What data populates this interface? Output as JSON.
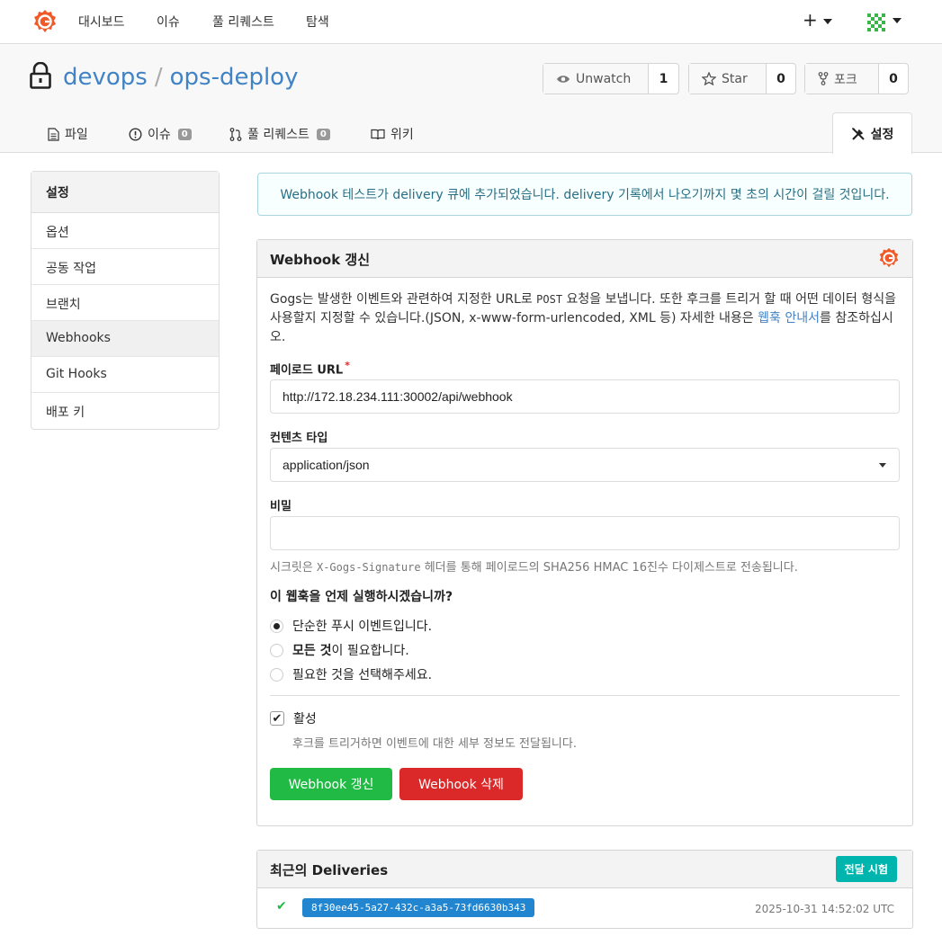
{
  "topnav": {
    "items": [
      "대시보드",
      "이슈",
      "풀 리퀘스트",
      "탐색"
    ],
    "plus": "+"
  },
  "repo": {
    "owner": "devops",
    "separator": "/",
    "name": "ops-deploy",
    "watch_label": "Unwatch",
    "watch_count": "1",
    "star_label": "Star",
    "star_count": "0",
    "fork_label": "포크",
    "fork_count": "0"
  },
  "tabs": {
    "files": "파일",
    "issues": "이슈",
    "issues_count": "0",
    "pulls": "풀 리퀘스트",
    "pulls_count": "0",
    "wiki": "위키",
    "settings": "설정"
  },
  "sidebar": {
    "header": "설정",
    "items": [
      "옵션",
      "공동 작업",
      "브랜치",
      "Webhooks",
      "Git Hooks",
      "배포 키"
    ],
    "active_index": 3
  },
  "flash": {
    "message": "Webhook 테스트가 delivery 큐에 추가되었습니다. delivery 기록에서 나오기까지 몇 초의 시간이 걸릴 것입니다."
  },
  "form": {
    "title": "Webhook 갱신",
    "desc_part1": "Gogs는 발생한 이벤트와 관련하여 지정한 URL로 ",
    "desc_code": "POST",
    "desc_part2": " 요청을 보냅니다. 또한 후크를 트리거 할 때 어떤 데이터 형식을 사용할지 지정할 수 있습니다.(JSON, x-www-form-urlencoded, XML 등) 자세한 내용은 ",
    "desc_link": "웹훅 안내서",
    "desc_part3": "를 참조하십시오.",
    "payload_label": "페이로드 URL",
    "required_mark": "*",
    "payload_value": "http://172.18.234.111:30002/api/webhook",
    "content_type_label": "컨텐츠 타입",
    "content_type_value": "application/json",
    "secret_label": "비밀",
    "secret_value": "",
    "secret_help_part1": "시크릿은 ",
    "secret_help_code": "X-Gogs-Signature",
    "secret_help_part2": " 헤더를 통해 페이로드의 SHA256 HMAC 16진수 다이제스트로 전송됩니다.",
    "events_question": "이 웹훅을 언제 실행하시겠습니까?",
    "event_push": "단순한 푸시 이벤트입니다.",
    "event_all_bold": "모든 것",
    "event_all_rest": "이 필요합니다.",
    "event_choose": "필요한 것을 선택해주세요.",
    "selected_event": "push",
    "active_label": "활성",
    "active_checked": true,
    "active_help": "후크를 트리거하면 이벤트에 대한 세부 정보도 전달됩니다.",
    "update_button": "Webhook 갱신",
    "delete_button": "Webhook 삭제"
  },
  "deliveries": {
    "title": "최근의 Deliveries",
    "test_button": "전달 시험",
    "items": [
      {
        "status": "success",
        "uuid": "8f30ee45-5a27-432c-a3a5-73fd6630b343",
        "time": "2025-10-31 14:52:02 UTC"
      }
    ]
  },
  "colors": {
    "link": "#4183c4",
    "green": "#21ba45",
    "red": "#db2828",
    "teal": "#00b5ad",
    "blue": "#2185d0",
    "brand": "#f05a28"
  }
}
